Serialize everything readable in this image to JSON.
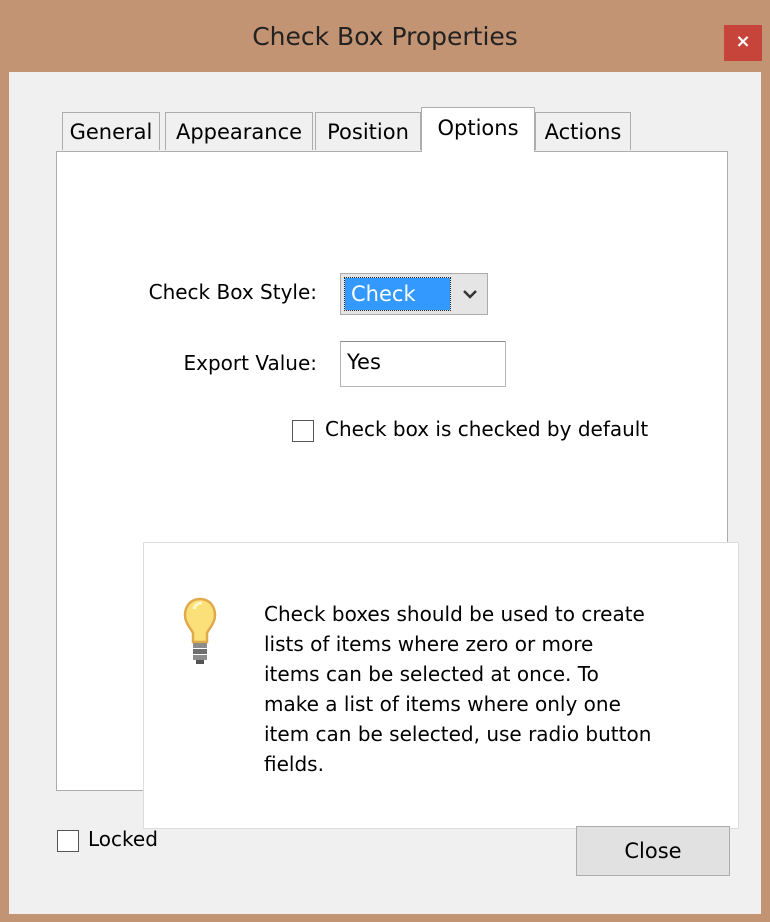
{
  "window": {
    "title": "Check Box Properties",
    "close_label": "×"
  },
  "tabs": [
    {
      "label": "General"
    },
    {
      "label": "Appearance"
    },
    {
      "label": "Position"
    },
    {
      "label": "Options",
      "active": true
    },
    {
      "label": "Actions"
    }
  ],
  "options": {
    "style_label": "Check Box Style:",
    "style_value": "Check",
    "export_label": "Export Value:",
    "export_value": "Yes",
    "default_checked_label": "Check box is checked by default",
    "default_checked": false
  },
  "info": {
    "icon": "lightbulb-icon",
    "text": "Check boxes should be used to create lists of items where zero or more items can be selected at once. To make a list of items where only one item can be selected, use radio button fields."
  },
  "footer": {
    "locked_label": "Locked",
    "locked": false,
    "close_button": "Close"
  },
  "colors": {
    "frame": "#c39474",
    "close_button": "#c7443a",
    "selection": "#3399ff"
  }
}
